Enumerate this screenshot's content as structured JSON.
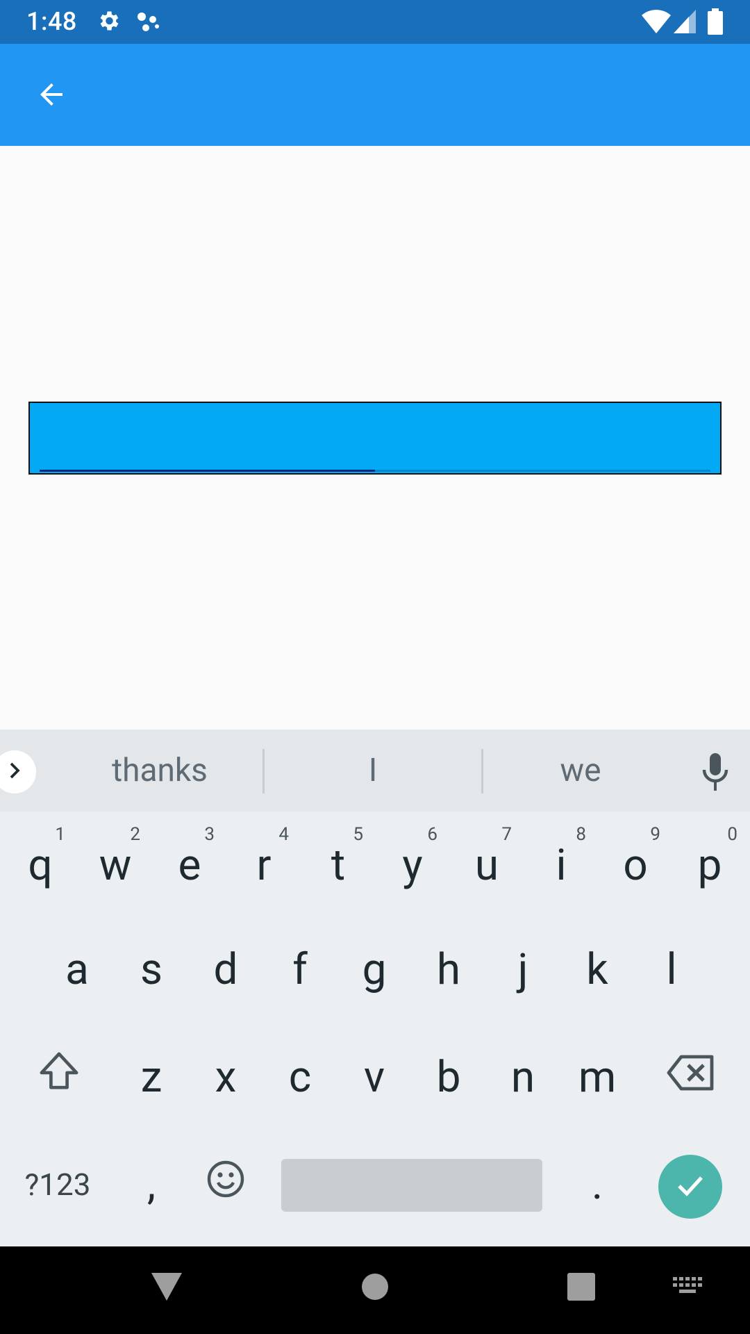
{
  "status_bar": {
    "time": "1:48"
  },
  "app_bar": {
    "back_icon": "arrow-back-icon"
  },
  "input": {
    "value": ""
  },
  "keyboard": {
    "suggestions": [
      "thanks",
      "I",
      "we"
    ],
    "row1": [
      {
        "k": "q",
        "h": "1"
      },
      {
        "k": "w",
        "h": "2"
      },
      {
        "k": "e",
        "h": "3"
      },
      {
        "k": "r",
        "h": "4"
      },
      {
        "k": "t",
        "h": "5"
      },
      {
        "k": "y",
        "h": "6"
      },
      {
        "k": "u",
        "h": "7"
      },
      {
        "k": "i",
        "h": "8"
      },
      {
        "k": "o",
        "h": "9"
      },
      {
        "k": "p",
        "h": "0"
      }
    ],
    "row2": [
      "a",
      "s",
      "d",
      "f",
      "g",
      "h",
      "j",
      "k",
      "l"
    ],
    "row3": [
      "z",
      "x",
      "c",
      "v",
      "b",
      "n",
      "m"
    ],
    "symbols_label": "?123",
    "comma_label": ",",
    "period_label": ".",
    "accent_color": "#4db6ac"
  },
  "colors": {
    "status_bar": "#1a6fba",
    "app_bar": "#2196f3",
    "input_fill": "#03a9f4"
  }
}
